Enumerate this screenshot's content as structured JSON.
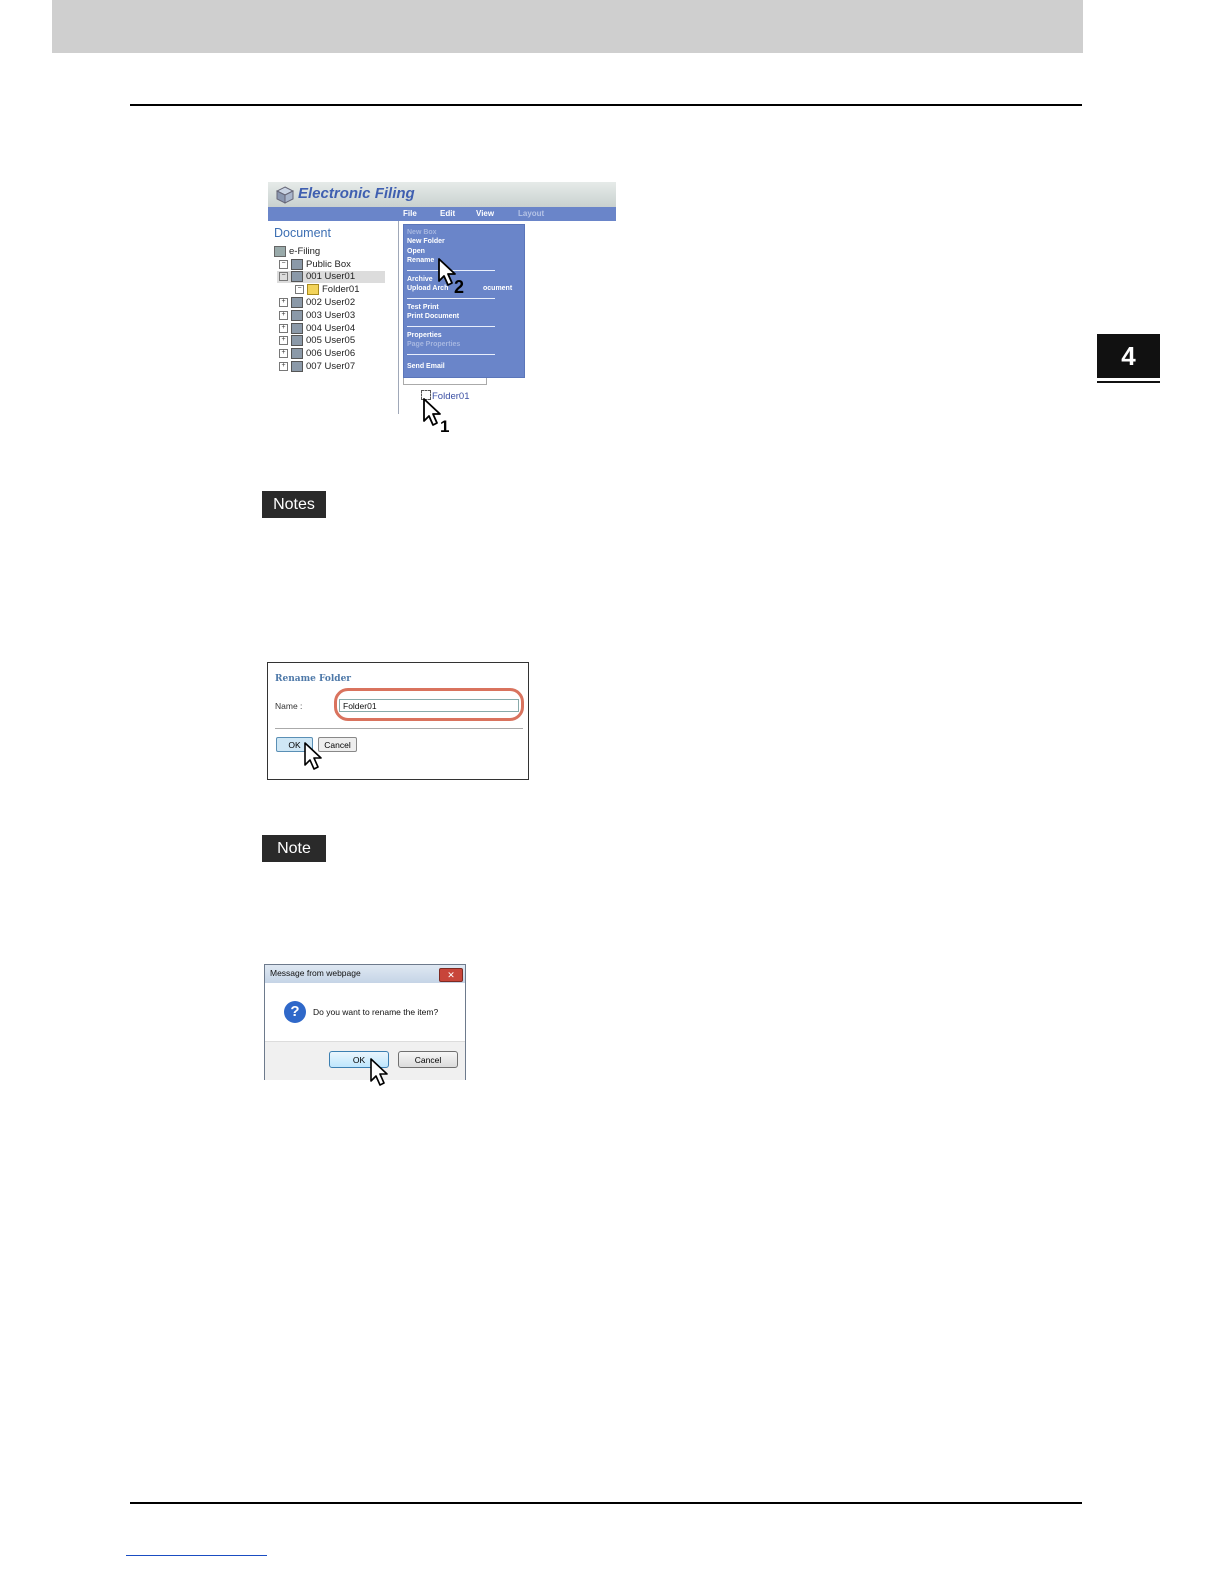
{
  "chapter": {
    "number": "4"
  },
  "electronic_filing": {
    "title": "Electronic Filing",
    "menu": [
      "File",
      "Edit",
      "View",
      "Layout"
    ],
    "tree_heading": "Document",
    "tree": [
      "e-Filing",
      "Public Box",
      "001 User01",
      "Folder01",
      "002 User02",
      "003 User03",
      "004 User04",
      "005 User05",
      "006 User06",
      "007 User07"
    ],
    "dropdown": {
      "new_box": "New Box",
      "new_folder": "New Folder",
      "open": "Open",
      "rename": "Rename",
      "archive": "Archive",
      "upload": "Upload Arch",
      "upload_tail": "ocument",
      "test_print": "Test Print",
      "print_document": "Print Document",
      "properties": "Properties",
      "page_properties": "Page Properties",
      "send_email": "Send Email"
    },
    "folder_item": "Folder01",
    "callouts": [
      "1",
      "2"
    ]
  },
  "notes_labels": {
    "first": "Notes",
    "second": "Note"
  },
  "rename_dialog": {
    "title": "Rename Folder",
    "name_label": "Name :",
    "name_value": "Folder01",
    "ok": "OK",
    "cancel": "Cancel"
  },
  "message_box": {
    "title": "Message from webpage",
    "close": "✕",
    "icon": "?",
    "text": "Do you want to rename the item?",
    "ok": "OK",
    "cancel": "Cancel"
  }
}
